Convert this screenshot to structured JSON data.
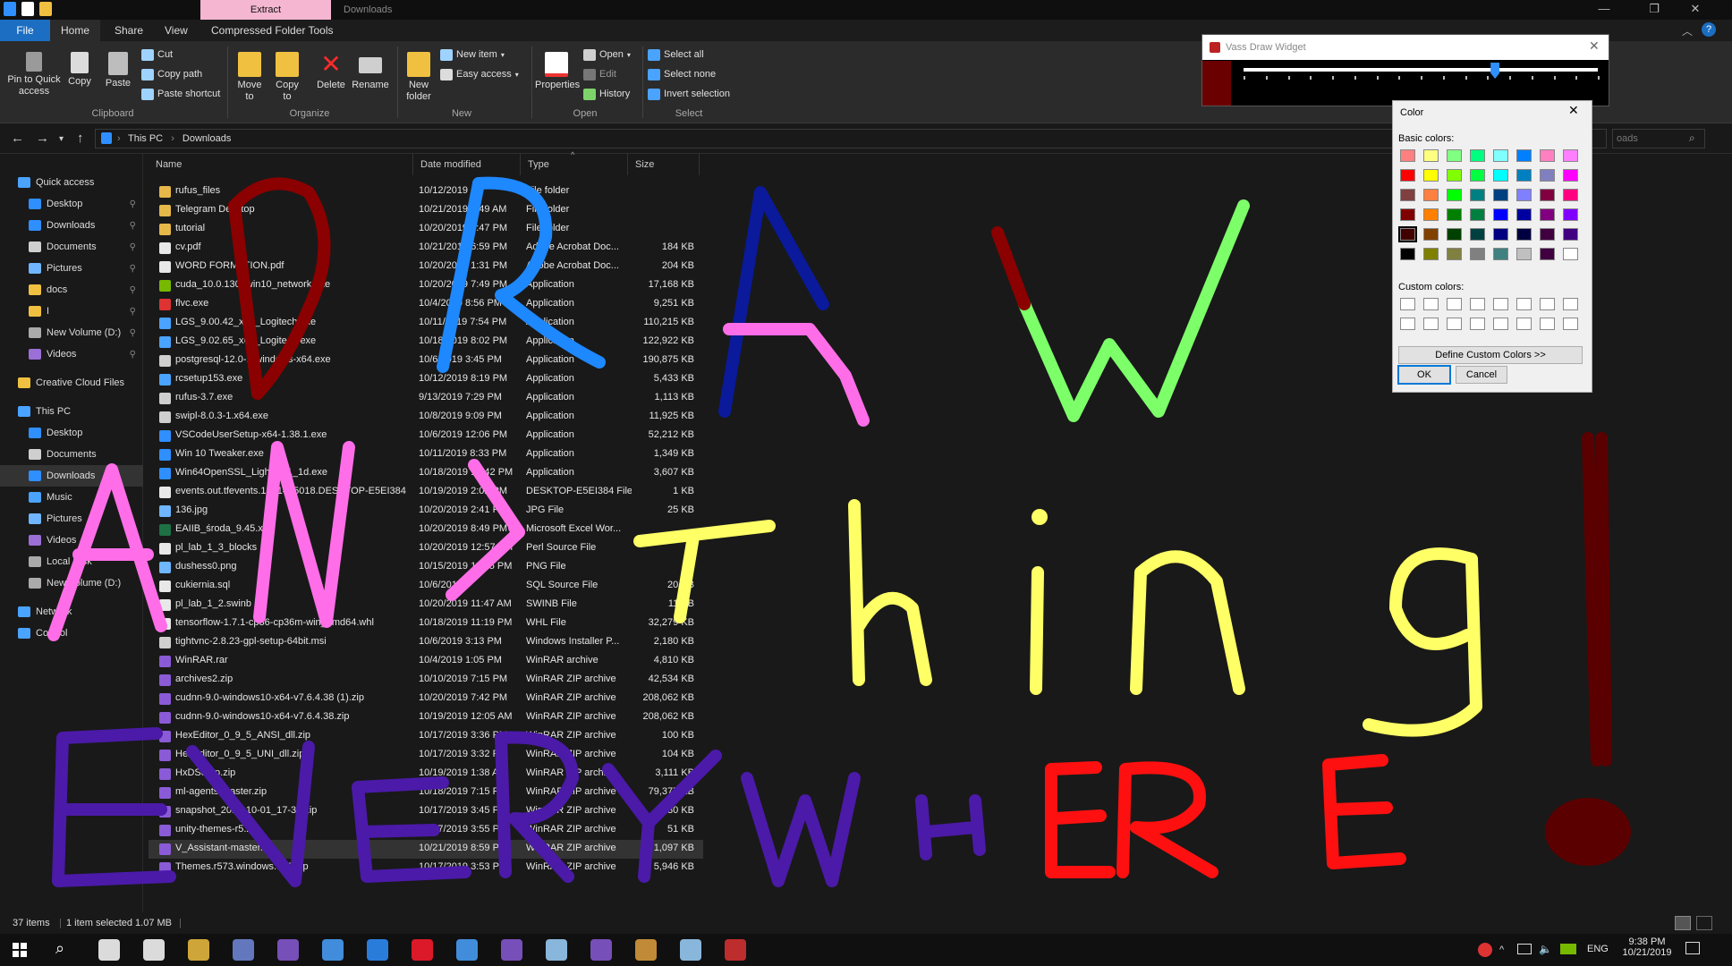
{
  "window": {
    "context_tab": "Extract",
    "title": "Downloads",
    "tabs": [
      "File",
      "Home",
      "Share",
      "View",
      "Compressed Folder Tools"
    ],
    "controls": {
      "minimize": "—",
      "maximize": "❐",
      "close": "✕"
    }
  },
  "ribbon": {
    "clipboard": {
      "label": "Clipboard",
      "pin": "Pin to Quick access",
      "copy": "Copy",
      "paste": "Paste",
      "cut": "Cut",
      "copy_path": "Copy path",
      "paste_shortcut": "Paste shortcut"
    },
    "organize": {
      "label": "Organize",
      "move_to": "Move to",
      "copy_to": "Copy to",
      "delete": "Delete",
      "rename": "Rename"
    },
    "new": {
      "label": "New",
      "new_folder": "New folder",
      "new_item": "New item",
      "easy_access": "Easy access"
    },
    "open": {
      "label": "Open",
      "properties": "Properties",
      "open": "Open",
      "edit": "Edit",
      "history": "History"
    },
    "select": {
      "label": "Select",
      "select_all": "Select all",
      "select_none": "Select none",
      "invert": "Invert selection"
    }
  },
  "address": {
    "path": [
      "This PC",
      "Downloads"
    ],
    "search_placeholder": "oads"
  },
  "nav": {
    "items": [
      {
        "label": "Quick access",
        "color": "#4aa3ff",
        "indent": 0,
        "pin": false
      },
      {
        "label": "Desktop",
        "color": "#2f8fff",
        "indent": 1,
        "pin": true
      },
      {
        "label": "Downloads",
        "color": "#2f8fff",
        "indent": 1,
        "pin": true
      },
      {
        "label": "Documents",
        "color": "#cfcfcf",
        "indent": 1,
        "pin": true
      },
      {
        "label": "Pictures",
        "color": "#6fb6ff",
        "indent": 1,
        "pin": true
      },
      {
        "label": "docs",
        "color": "#f0c040",
        "indent": 1,
        "pin": true
      },
      {
        "label": "I",
        "color": "#f0c040",
        "indent": 1,
        "pin": true
      },
      {
        "label": "New Volume (D:)",
        "color": "#aaaaaa",
        "indent": 1,
        "pin": true
      },
      {
        "label": "Videos",
        "color": "#9b6fd6",
        "indent": 1,
        "pin": true
      },
      {
        "label": "Creative Cloud Files",
        "color": "#f0c040",
        "indent": 0,
        "pin": false
      },
      {
        "label": "This PC",
        "color": "#4aa3ff",
        "indent": 0,
        "pin": false
      },
      {
        "label": "Desktop",
        "color": "#2f8fff",
        "indent": 1,
        "pin": false
      },
      {
        "label": "Documents",
        "color": "#cfcfcf",
        "indent": 1,
        "pin": false
      },
      {
        "label": "Downloads",
        "color": "#2f8fff",
        "indent": 1,
        "pin": false
      },
      {
        "label": "Music",
        "color": "#4aa3ff",
        "indent": 1,
        "pin": false
      },
      {
        "label": "Pictures",
        "color": "#6fb6ff",
        "indent": 1,
        "pin": false
      },
      {
        "label": "Videos",
        "color": "#9b6fd6",
        "indent": 1,
        "pin": false
      },
      {
        "label": "Local Disk",
        "color": "#aaaaaa",
        "indent": 1,
        "pin": false
      },
      {
        "label": "New Volume (D:)",
        "color": "#aaaaaa",
        "indent": 1,
        "pin": false
      },
      {
        "label": "Network",
        "color": "#4aa3ff",
        "indent": 0,
        "pin": false
      },
      {
        "label": "Control",
        "color": "#4aa3ff",
        "indent": 0,
        "pin": false
      }
    ]
  },
  "columns": {
    "name": "Name",
    "date": "Date modified",
    "type": "Type",
    "size": "Size"
  },
  "files": [
    {
      "name": "rufus_files",
      "date": "10/12/2019",
      "type": "File folder",
      "size": "",
      "icon": "#e6b84a"
    },
    {
      "name": "Telegram Desktop",
      "date": "10/21/2019 3:49 AM",
      "type": "File folder",
      "size": "",
      "icon": "#e6b84a"
    },
    {
      "name": "tutorial",
      "date": "10/20/2019 3:47 PM",
      "type": "File folder",
      "size": "",
      "icon": "#e6b84a"
    },
    {
      "name": "cv.pdf",
      "date": "10/21/2019 6:59 PM",
      "type": "Adobe Acrobat Doc...",
      "size": "184 KB",
      "icon": "#e8e8e8"
    },
    {
      "name": "WORD FORMATION.pdf",
      "date": "10/20/2019 1:31 PM",
      "type": "Adobe Acrobat Doc...",
      "size": "204 KB",
      "icon": "#e8e8e8"
    },
    {
      "name": "cuda_10.0.130_win10_network.exe",
      "date": "10/20/2019 7:49 PM",
      "type": "Application",
      "size": "17,168 KB",
      "icon": "#76b900"
    },
    {
      "name": "flvc.exe",
      "date": "10/4/2019 8:56 PM",
      "type": "Application",
      "size": "9,251 KB",
      "icon": "#d33"
    },
    {
      "name": "LGS_9.00.42_x64_Logitech.exe",
      "date": "10/11/2019 7:54 PM",
      "type": "Application",
      "size": "110,215 KB",
      "icon": "#4aa3ff"
    },
    {
      "name": "LGS_9.02.65_x64_Logitech.exe",
      "date": "10/18/2019 8:02 PM",
      "type": "Application",
      "size": "122,922 KB",
      "icon": "#4aa3ff"
    },
    {
      "name": "postgresql-12.0-1-windows-x64.exe",
      "date": "10/6/2019 3:45 PM",
      "type": "Application",
      "size": "190,875 KB",
      "icon": "#cfcfcf"
    },
    {
      "name": "rcsetup153.exe",
      "date": "10/12/2019 8:19 PM",
      "type": "Application",
      "size": "5,433 KB",
      "icon": "#4aa3ff"
    },
    {
      "name": "rufus-3.7.exe",
      "date": "9/13/2019 7:29 PM",
      "type": "Application",
      "size": "1,113 KB",
      "icon": "#cfcfcf"
    },
    {
      "name": "swipl-8.0.3-1.x64.exe",
      "date": "10/8/2019 9:09 PM",
      "type": "Application",
      "size": "11,925 KB",
      "icon": "#cfcfcf"
    },
    {
      "name": "VSCodeUserSetup-x64-1.38.1.exe",
      "date": "10/6/2019 12:06 PM",
      "type": "Application",
      "size": "52,212 KB",
      "icon": "#2f8fff"
    },
    {
      "name": "Win 10 Tweaker.exe",
      "date": "10/11/2019 8:33 PM",
      "type": "Application",
      "size": "1,349 KB",
      "icon": "#2f8fff"
    },
    {
      "name": "Win64OpenSSL_Light-1_1_1d.exe",
      "date": "10/18/2019 10:42 PM",
      "type": "Application",
      "size": "3,607 KB",
      "icon": "#2f8fff"
    },
    {
      "name": "events.out.tfevents.1571485018.DESKTOP-E5EI384",
      "date": "10/19/2019 2:02 PM",
      "type": "DESKTOP-E5EI384 File",
      "size": "1 KB",
      "icon": "#e8e8e8"
    },
    {
      "name": "136.jpg",
      "date": "10/20/2019 2:41 PM",
      "type": "JPG File",
      "size": "25 KB",
      "icon": "#6fb6ff"
    },
    {
      "name": "EAIIB_środa_9.45.xlsx",
      "date": "10/20/2019 8:49 PM",
      "type": "Microsoft Excel Wor...",
      "size": "",
      "icon": "#1e7145"
    },
    {
      "name": "pl_lab_1_3_blocks",
      "date": "10/20/2019 12:57 PM",
      "type": "Perl Source File",
      "size": "",
      "icon": "#e8e8e8"
    },
    {
      "name": "dushess0.png",
      "date": "10/15/2019 11:45 PM",
      "type": "PNG File",
      "size": "",
      "icon": "#6fb6ff"
    },
    {
      "name": "cukiernia.sql",
      "date": "10/6/2019",
      "type": "SQL Source File",
      "size": "20 KB",
      "icon": "#e8e8e8"
    },
    {
      "name": "pl_lab_1_2.swinb",
      "date": "10/20/2019 11:47 AM",
      "type": "SWINB File",
      "size": "11 KB",
      "icon": "#e8e8e8"
    },
    {
      "name": "tensorflow-1.7.1-cp36-cp36m-win_amd64.whl",
      "date": "10/18/2019 11:19 PM",
      "type": "WHL File",
      "size": "32,279 KB",
      "icon": "#e8e8e8"
    },
    {
      "name": "tightvnc-2.8.23-gpl-setup-64bit.msi",
      "date": "10/6/2019 3:13 PM",
      "type": "Windows Installer P...",
      "size": "2,180 KB",
      "icon": "#cfcfcf"
    },
    {
      "name": "WinRAR.rar",
      "date": "10/4/2019 1:05 PM",
      "type": "WinRAR archive",
      "size": "4,810 KB",
      "icon": "#8a5bd6"
    },
    {
      "name": "archives2.zip",
      "date": "10/10/2019 7:15 PM",
      "type": "WinRAR ZIP archive",
      "size": "42,534 KB",
      "icon": "#8a5bd6"
    },
    {
      "name": "cudnn-9.0-windows10-x64-v7.6.4.38 (1).zip",
      "date": "10/20/2019 7:42 PM",
      "type": "WinRAR ZIP archive",
      "size": "208,062 KB",
      "icon": "#8a5bd6"
    },
    {
      "name": "cudnn-9.0-windows10-x64-v7.6.4.38.zip",
      "date": "10/19/2019 12:05 AM",
      "type": "WinRAR ZIP archive",
      "size": "208,062 KB",
      "icon": "#8a5bd6"
    },
    {
      "name": "HexEditor_0_9_5_ANSI_dll.zip",
      "date": "10/17/2019 3:36 PM",
      "type": "WinRAR ZIP archive",
      "size": "100 KB",
      "icon": "#8a5bd6"
    },
    {
      "name": "HexEditor_0_9_5_UNI_dll.zip",
      "date": "10/17/2019 3:32 PM",
      "type": "WinRAR ZIP archive",
      "size": "104 KB",
      "icon": "#8a5bd6"
    },
    {
      "name": "HxDSetup.zip",
      "date": "10/19/2019 1:38 AM",
      "type": "WinRAR ZIP archive",
      "size": "3,111 KB",
      "icon": "#8a5bd6"
    },
    {
      "name": "ml-agents-master.zip",
      "date": "10/18/2019 7:15 PM",
      "type": "WinRAR ZIP archive",
      "size": "79,377 KB",
      "icon": "#8a5bd6"
    },
    {
      "name": "snapshot_2019-10-01_17-37.zip",
      "date": "10/17/2019 3:45 PM",
      "type": "WinRAR ZIP archive",
      "size": "30 KB",
      "icon": "#8a5bd6"
    },
    {
      "name": "unity-themes-r5.zip",
      "date": "10/17/2019 3:55 PM",
      "type": "WinRAR ZIP archive",
      "size": "51 KB",
      "icon": "#8a5bd6"
    },
    {
      "name": "V_Assistant-master.zip",
      "date": "10/21/2019 8:59 PM",
      "type": "WinRAR ZIP archive",
      "size": "1,097 KB",
      "icon": "#8a5bd6",
      "selected": true
    },
    {
      "name": "Themes.r573.windows.560.zip",
      "date": "10/17/2019 3:53 PM",
      "type": "WinRAR ZIP archive",
      "size": "5,946 KB",
      "icon": "#8a5bd6"
    }
  ],
  "status": {
    "items": "37 items",
    "selected": "1 item selected  1.07 MB"
  },
  "widget": {
    "title": "Vass Draw Widget",
    "accent": "#6b0000",
    "slider_value": 0.71
  },
  "color_dialog": {
    "title": "Color",
    "basic_label": "Basic colors:",
    "custom_label": "Custom colors:",
    "define_button": "Define Custom Colors >>",
    "ok": "OK",
    "cancel": "Cancel",
    "basic_colors": [
      "#ff8080",
      "#ffff80",
      "#80ff80",
      "#00ff80",
      "#80ffff",
      "#0080ff",
      "#ff80c0",
      "#ff80ff",
      "#ff0000",
      "#ffff00",
      "#80ff00",
      "#00ff40",
      "#00ffff",
      "#0080c0",
      "#8080c0",
      "#ff00ff",
      "#804040",
      "#ff8040",
      "#00ff00",
      "#008080",
      "#004080",
      "#8080ff",
      "#800040",
      "#ff0080",
      "#800000",
      "#ff8000",
      "#008000",
      "#008040",
      "#0000ff",
      "#0000a0",
      "#800080",
      "#8000ff",
      "#400000",
      "#804000",
      "#004000",
      "#004040",
      "#000080",
      "#000040",
      "#400040",
      "#400080",
      "#000000",
      "#808000",
      "#808040",
      "#808080",
      "#408080",
      "#c0c0c0",
      "#400040",
      "#ffffff"
    ],
    "selected_index": 32
  },
  "taskbar": {
    "apps": [
      "#ffffff",
      "#ffffff",
      "#f0c040",
      "#7289da",
      "#8a5bd6",
      "#4aa3ff",
      "#2f8fff",
      "#ff1b2d",
      "#4aa3ff",
      "#8a5bd6",
      "#9fd3ff",
      "#8a5bd6",
      "#e0a040",
      "#9fd3ff",
      "#d33"
    ],
    "language": "ENG",
    "time": "9:38 PM",
    "date": "10/21/2019"
  },
  "drawing": {
    "words": [
      "DRAW",
      "ANYThing",
      "EVERYWHERE"
    ],
    "colors": {
      "maroon": "#8b0000",
      "blue": "#1e88ff",
      "navy": "#0a1a9a",
      "green": "#7dff6a",
      "pink": "#ff6ee8",
      "yellow": "#ffff66",
      "purple": "#4b1aa8",
      "red": "#ff1010",
      "dark": "#5a0000"
    }
  }
}
